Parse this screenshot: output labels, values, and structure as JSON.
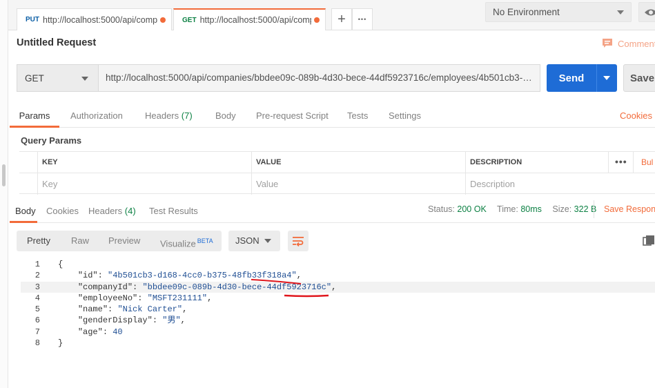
{
  "tabs": [
    {
      "method": "PUT",
      "url": "http://localhost:5000/api/comp..."
    },
    {
      "method": "GET",
      "url": "http://localhost:5000/api/comp..."
    }
  ],
  "tab_actions": {
    "new": "+",
    "more": "•••"
  },
  "environment": {
    "selected": "No Environment"
  },
  "request": {
    "title": "Untitled Request",
    "comments_label": "Comment",
    "method": "GET",
    "url": "http://localhost:5000/api/companies/bbdee09c-089b-4d30-bece-44df5923716c/employees/4b501cb3-d168-...",
    "send_label": "Send",
    "save_label": "Save"
  },
  "request_tabs": {
    "params": "Params",
    "authorization": "Authorization",
    "headers": "Headers",
    "headers_count": "(7)",
    "body": "Body",
    "prerequest": "Pre-request Script",
    "tests": "Tests",
    "settings": "Settings",
    "cookies": "Cookies"
  },
  "query_params": {
    "title": "Query Params",
    "columns": [
      "KEY",
      "VALUE",
      "DESCRIPTION"
    ],
    "placeholders": [
      "Key",
      "Value",
      "Description"
    ],
    "menu": "•••",
    "bulk": "Bul"
  },
  "response_tabs": {
    "body": "Body",
    "cookies": "Cookies",
    "headers": "Headers",
    "headers_count": "(4)",
    "test_results": "Test Results"
  },
  "response_meta": {
    "status_label": "Status:",
    "status_value": "200 OK",
    "time_label": "Time:",
    "time_value": "80ms",
    "size_label": "Size:",
    "size_value": "322 B",
    "save_response": "Save Respon"
  },
  "response_view": {
    "pretty": "Pretty",
    "raw": "Raw",
    "preview": "Preview",
    "visualize": "Visualize",
    "beta": "BETA",
    "format": "JSON"
  },
  "code_lines": [
    {
      "n": "1",
      "k": "",
      "v": "",
      "pre": "{",
      "post": ""
    },
    {
      "n": "2",
      "k": "\"id\"",
      "v": "\"4b501cb3-d168-4cc0-b375-48fb33f318a4\"",
      "pre": "    ",
      "post": ","
    },
    {
      "n": "3",
      "k": "\"companyId\"",
      "v": "\"bbdee09c-089b-4d30-bece-44df5923716c\"",
      "pre": "    ",
      "post": ","
    },
    {
      "n": "4",
      "k": "\"employeeNo\"",
      "v": "\"MSFT231111\"",
      "pre": "    ",
      "post": ","
    },
    {
      "n": "5",
      "k": "\"name\"",
      "v": "\"Nick Carter\"",
      "pre": "    ",
      "post": ","
    },
    {
      "n": "6",
      "k": "\"genderDisplay\"",
      "v": "\"男\"",
      "pre": "    ",
      "post": ","
    },
    {
      "n": "7",
      "k": "\"age\"",
      "v": "40",
      "pre": "    ",
      "post": ""
    },
    {
      "n": "8",
      "k": "",
      "v": "",
      "pre": "}",
      "post": ""
    }
  ],
  "colors": {
    "accent": "#f26b3a",
    "send": "#1e6cd6",
    "success": "#0d8144",
    "annotation": "#e0161c"
  }
}
